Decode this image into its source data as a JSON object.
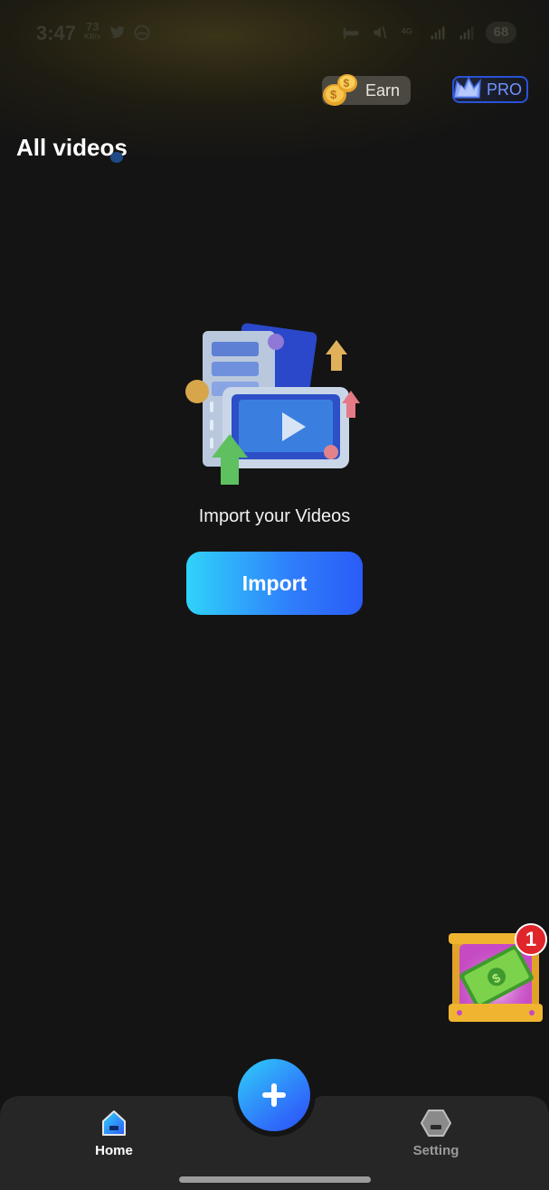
{
  "status_bar": {
    "time": "3:47",
    "speed_value": "73",
    "speed_unit": "KB/s",
    "battery": "68",
    "icons": [
      "twitter-bird-icon",
      "headset-icon",
      "bed-icon",
      "mute-icon",
      "4g-icon",
      "signal-icon",
      "signal-icon-2"
    ]
  },
  "header": {
    "earn_label": "Earn",
    "pro_label": "PRO",
    "title": "All videos"
  },
  "empty_state": {
    "caption": "Import your Videos",
    "import_label": "Import"
  },
  "reward": {
    "badge_count": "1"
  },
  "bottom_nav": {
    "home_label": "Home",
    "setting_label": "Setting"
  },
  "colors": {
    "background": "#141414",
    "accent_start": "#2fd3f9",
    "accent_end": "#2a5cf7",
    "pro_blue": "#2a52d8",
    "inactive_gray": "#9a9a9a"
  }
}
